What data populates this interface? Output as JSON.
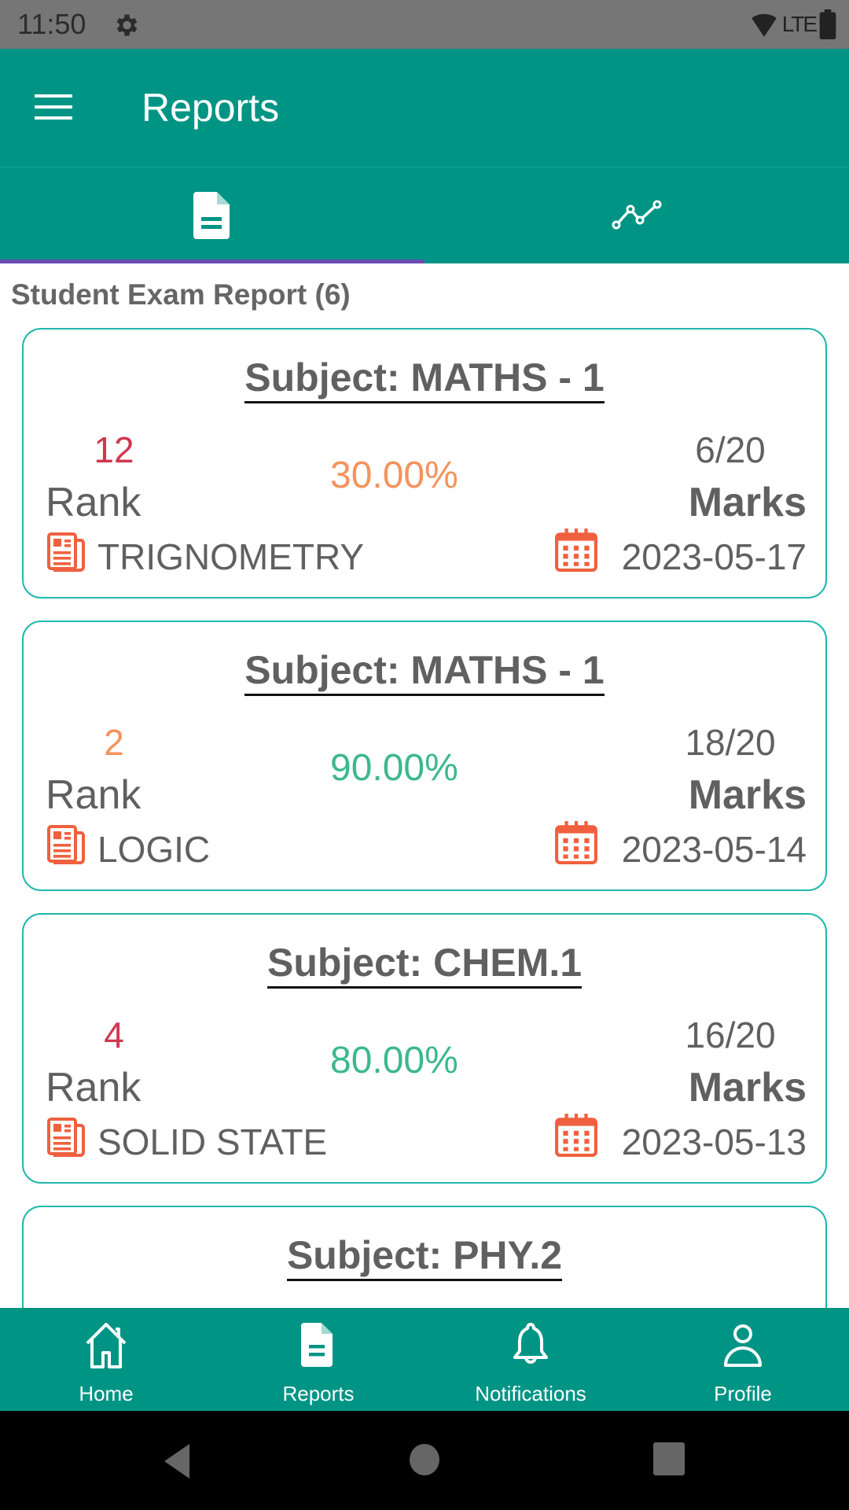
{
  "status_bar": {
    "time": "11:50",
    "network": "LTE"
  },
  "app_bar": {
    "title": "Reports"
  },
  "tabs": [
    {
      "name": "exam-report",
      "icon": "document-icon",
      "selected": true
    },
    {
      "name": "performance-chart",
      "icon": "line-chart-icon",
      "selected": false
    }
  ],
  "list": {
    "title": "Student Exam Report (6)",
    "rank_label": "Rank",
    "marks_label": "Marks",
    "cards": [
      {
        "subject": "Subject: MATHS - 1",
        "rank": "12",
        "rank_color": "#d0374f",
        "percentage": "30.00%",
        "percentage_color": "#f4935c",
        "marks": "6/20",
        "topic": "TRIGNOMETRY",
        "date": "2023-05-17"
      },
      {
        "subject": "Subject: MATHS - 1",
        "rank": "2",
        "rank_color": "#f4935c",
        "percentage": "90.00%",
        "percentage_color": "#3db88e",
        "marks": "18/20",
        "topic": "LOGIC",
        "date": "2023-05-14"
      },
      {
        "subject": "Subject: CHEM.1",
        "rank": "4",
        "rank_color": "#d0374f",
        "percentage": "80.00%",
        "percentage_color": "#3db88e",
        "marks": "16/20",
        "topic": "SOLID STATE",
        "date": "2023-05-13"
      },
      {
        "subject": "Subject: PHY.2"
      }
    ]
  },
  "bottom_nav": [
    {
      "label": "Home",
      "icon": "home-icon"
    },
    {
      "label": "Reports",
      "icon": "document-icon",
      "active": true
    },
    {
      "label": "Notifications",
      "icon": "bell-icon"
    },
    {
      "label": "Profile",
      "icon": "person-icon"
    }
  ],
  "colors": {
    "primary": "#009485",
    "card_border": "#1fb8ad",
    "tab_indicator": "#6a4cb3",
    "icon_accent": "#f0603f"
  }
}
